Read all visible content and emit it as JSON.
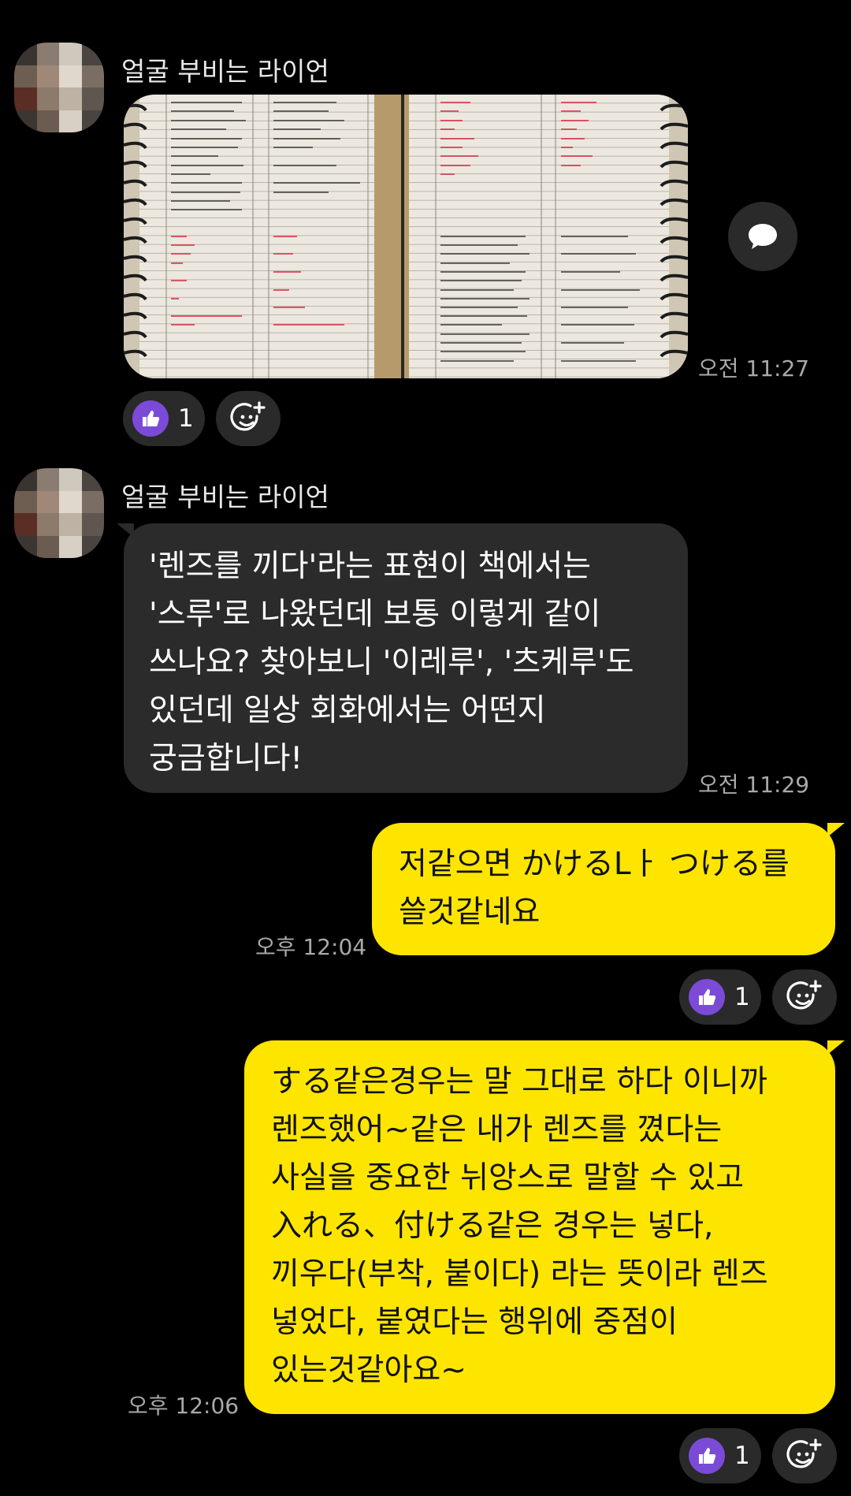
{
  "messages": [
    {
      "sender": "얼굴 부비는 라이언",
      "type": "image",
      "image_alt": "notebook-photo",
      "time": "오전 11:27",
      "reaction_count": "1"
    },
    {
      "sender": "얼굴 부비는 라이언",
      "type": "text",
      "text": "'렌즈를 끼다'라는 표현이 책에서는\n'스루'로 나왔던데 보통 이렇게 같이\n쓰나요? 찾아보니 '이레루', '츠케루'도\n있던데 일상 회화에서는 어떤지\n궁금합니다!",
      "time": "오전 11:29"
    },
    {
      "type": "text",
      "outgoing": true,
      "text": "저같으면 かけるLㅏ つける를\n쓸것같네요",
      "time": "오후 12:04",
      "reaction_count": "1"
    },
    {
      "type": "text",
      "outgoing": true,
      "text": "する같은경우는 말 그대로 하다 이니까\n렌즈했어~같은 내가 렌즈를 꼈다는\n사실을 중요한 뉘앙스로 말할 수 있고\n入れる、付ける같은 경우는 넣다,\n끼우다(부착, 붙이다) 라는 뜻이라 렌즈\n넣었다, 붙였다는 행위에 중점이\n있는것같아요~",
      "time": "오후 12:06",
      "reaction_count": "1"
    }
  ],
  "colors": {
    "background": "#000000",
    "incoming_bubble": "#2b2b2b",
    "outgoing_bubble": "#fee500",
    "like_badge": "#7b4bd8",
    "pill": "#2a2a2a"
  },
  "icons": {
    "like": "thumbs-up-icon",
    "add_reaction": "smile-plus-icon",
    "share": "speech-bubble-icon"
  }
}
